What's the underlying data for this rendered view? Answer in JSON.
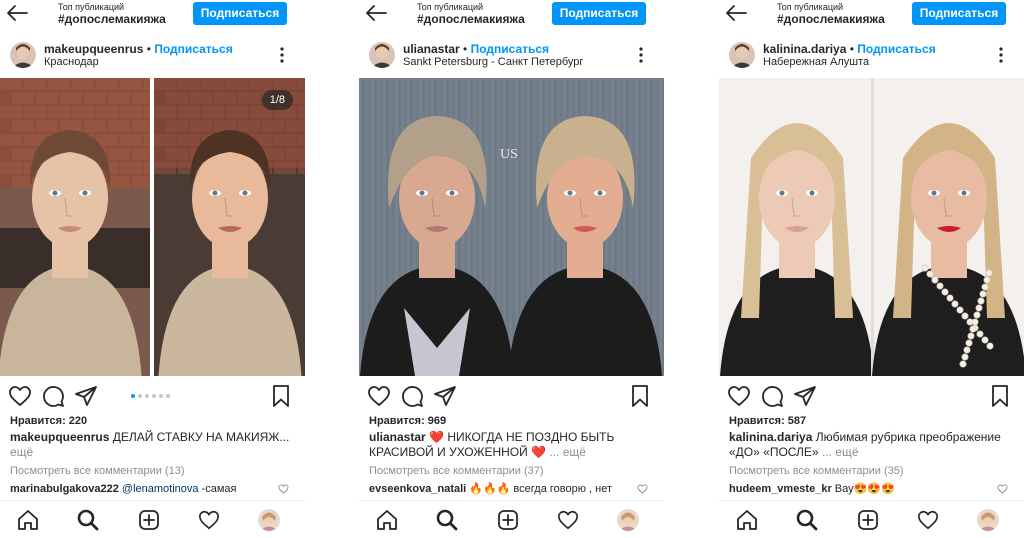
{
  "posts": [
    {
      "top_title": "Топ публикаций",
      "hashtag": "#допослемакияжа",
      "subscribe_label": "Подписаться",
      "username": "makeupqueenrus",
      "dot": " • ",
      "follow_label": "Подписаться",
      "location": "Краснодар",
      "counter": "1/8",
      "likes": "Нравится: 220",
      "caption_user": "makeupqueenrus",
      "caption_text": " ДЕЛАЙ СТАВКУ НА МАКИЯЖ...",
      "caption_more": "ещё",
      "view_comments": "Посмотреть все комментарии (13)",
      "comment_user": "marinabulgakova222",
      "comment_mention": " @lenamotinova",
      "comment_text": " -самая"
    },
    {
      "top_title": "Топ публикаций",
      "hashtag": "#допослемакияжа",
      "subscribe_label": "Подписаться",
      "username": "ulianastar",
      "dot": " • ",
      "follow_label": "Подписаться",
      "location": "Sankt Petersburg - Санкт Петербург",
      "likes": "Нравится: 969",
      "caption_user": "ulianastar",
      "caption_text": " ❤️ НИКОГДА НЕ ПОЗДНО БЫТЬ КРАСИВОЙ И УХОЖЕННОЙ ❤️",
      "caption_more": "... ещё",
      "view_comments": "Посмотреть все комментарии (37)",
      "comment_user": "evseenkova_natali",
      "comment_mention": "",
      "comment_text": " 🔥🔥🔥 всегда говорю , нет"
    },
    {
      "top_title": "Топ публикаций",
      "hashtag": "#допослемакияжа",
      "subscribe_label": "Подписаться",
      "username": "kalinina.dariya",
      "dot": " • ",
      "follow_label": "Подписаться",
      "location": "Набережная Алушта",
      "likes": "Нравится: 587",
      "caption_user": "kalinina.dariya",
      "caption_text": " Любимая рубрика преображение «ДО» «ПОСЛЕ»",
      "caption_more": "... ещё",
      "view_comments": "Посмотреть все комментарии (35)",
      "comment_user": "hudeem_vmeste_kr",
      "comment_mention": "",
      "comment_text": " Вау😍😍😍"
    }
  ],
  "icons": {
    "back": "arrow-left-icon",
    "more": "more-vertical-icon",
    "like": "heart-icon",
    "comment": "comment-icon",
    "share": "send-icon",
    "save": "bookmark-icon",
    "nav": [
      "home-icon",
      "search-icon",
      "new-post-icon",
      "activity-heart-icon",
      "profile-avatar"
    ]
  },
  "colors": {
    "accent": "#0095f6",
    "text": "#262626",
    "muted": "#8e8e8e",
    "pager_active": "#0095f6"
  }
}
